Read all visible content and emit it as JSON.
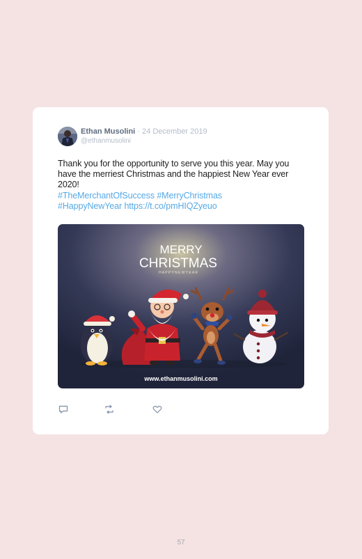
{
  "tweet": {
    "author_name": "Ethan Musolini",
    "separator": "·",
    "date": "24 December 2019",
    "handle": "@ethanmusolini",
    "text": "Thank you for the opportunity to serve you this year. May you have the merriest Christmas and the happiest New Year ever 2020!",
    "hashtags": [
      "#TheMerchantOfSuccess",
      "#MerryChristmas",
      "#HappyNewYear"
    ],
    "link": "https://t.co/pmHIQZyeuo",
    "image": {
      "title_line1": "MERRY",
      "title_line2": "CHRISTMAS",
      "subtitle": "H A P P Y   N E W   Y E A R",
      "website": "www.ethanmusolini.com"
    },
    "actions": {
      "reply_icon": "reply-icon",
      "retweet_icon": "retweet-icon",
      "like_icon": "heart-icon"
    }
  },
  "page": {
    "number": "57"
  },
  "colors": {
    "background": "#f5e3e4",
    "card": "#ffffff",
    "link": "#55a9e6",
    "muted": "#b4bcc8"
  }
}
